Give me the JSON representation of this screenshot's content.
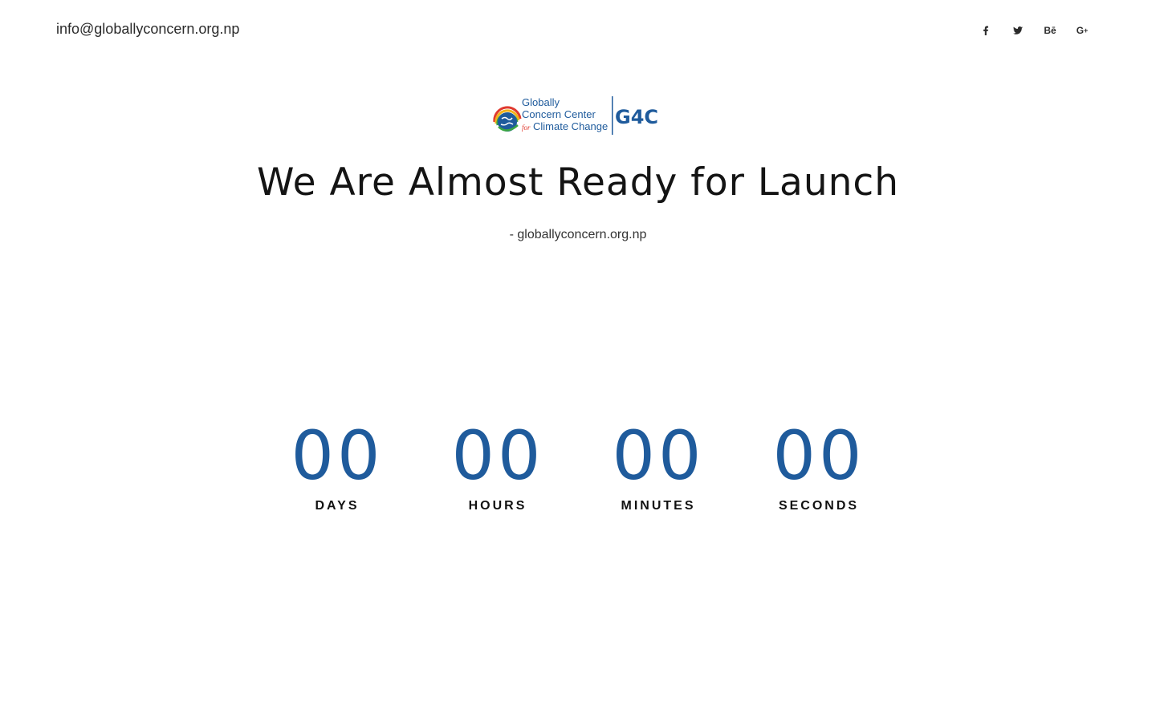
{
  "header": {
    "email": "info@globallyconcern.org.np",
    "social": [
      {
        "icon": "facebook-icon",
        "label": "f"
      },
      {
        "icon": "twitter-icon",
        "label": "🐦"
      },
      {
        "icon": "behance-icon",
        "label": "Bē"
      },
      {
        "icon": "google-plus-icon",
        "label": "G+"
      }
    ]
  },
  "logo": {
    "line1": "Globally",
    "line2": "Concern Center",
    "line3_small": "for",
    "line3": "Climate Change",
    "mark": "G4C"
  },
  "hero": {
    "headline": "We Are Almost Ready for Launch",
    "tagline": "- globallyconcern.org.np"
  },
  "countdown": [
    {
      "value": "00",
      "label": "DAYS"
    },
    {
      "value": "00",
      "label": "HOURS"
    },
    {
      "value": "00",
      "label": "MINUTES"
    },
    {
      "value": "00",
      "label": "SECONDS"
    }
  ],
  "colors": {
    "accent": "#1f5b9c",
    "text": "#141414"
  }
}
